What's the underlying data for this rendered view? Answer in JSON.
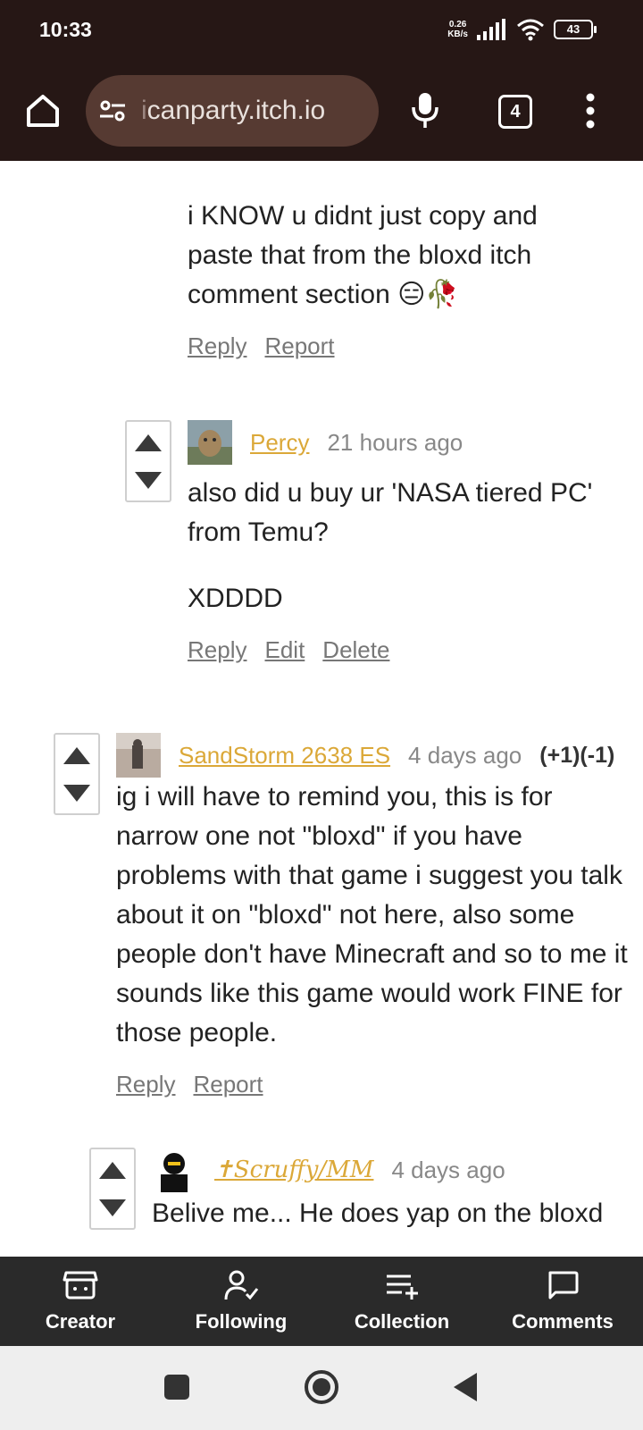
{
  "status_bar": {
    "time": "10:33",
    "net_speed_value": "0.26",
    "net_speed_unit": "KB/s",
    "battery": "43"
  },
  "browser": {
    "url_prefix": "i",
    "url_rest": "canparty.itch.io",
    "tabs_count": "4"
  },
  "comments": [
    {
      "body_lines": [
        "i KNOW u didnt just copy and",
        "paste that from the bloxd itch",
        "comment section 😑🥀"
      ],
      "actions": [
        "Reply",
        "Report"
      ]
    },
    {
      "author": "Percy",
      "time": "21 hours ago",
      "body_paragraphs": [
        "also did u buy ur 'NASA tiered PC' from Temu?",
        "XDDDD"
      ],
      "actions": [
        "Reply",
        "Edit",
        "Delete"
      ]
    },
    {
      "author": "SandStorm 2638 ES",
      "time": "4 days ago",
      "votes": "(+1)(-1)",
      "body": "ig i will have to remind you, this is for narrow one not \"bloxd\" if you have problems with that game i suggest you talk about it on \"bloxd\" not here, also some people don't have Minecraft and so to me it sounds like this game would work FINE for those people.",
      "actions": [
        "Reply",
        "Report"
      ]
    },
    {
      "author": "✝Scruffy/MM",
      "time": "4 days ago",
      "body": "Belive me... He does yap on the bloxd"
    }
  ],
  "bottom_nav": [
    {
      "label": "Creator",
      "icon": "storefront-icon"
    },
    {
      "label": "Following",
      "icon": "person-check-icon"
    },
    {
      "label": "Collection",
      "icon": "playlist-add-icon"
    },
    {
      "label": "Comments",
      "icon": "chat-bubble-icon"
    }
  ],
  "colors": {
    "topbar": "#261715",
    "url_pill": "#563a32",
    "author": "#dba838",
    "bottom_nav": "#2a2a2a"
  }
}
